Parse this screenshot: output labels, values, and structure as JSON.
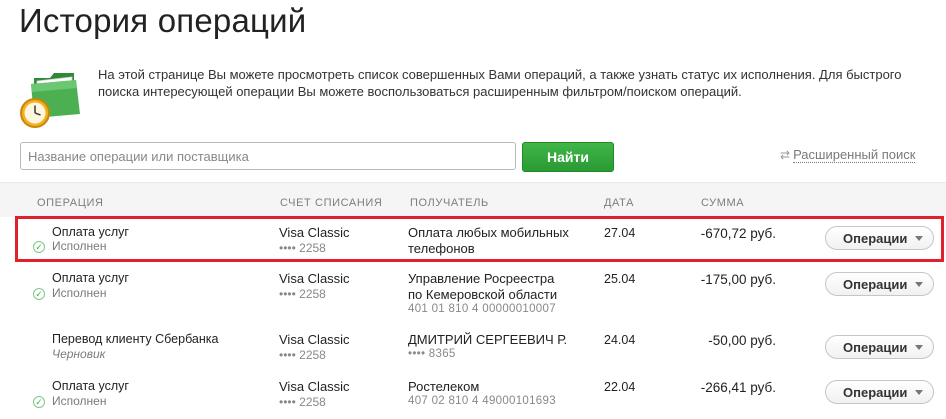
{
  "page": {
    "title": "История операций"
  },
  "intro": {
    "text": "На этой странице Вы можете просмотреть список совершенных Вами операций, а также узнать статус их исполнения. Для быстрого поиска интересующей операции Вы можете воспользоваться расширенным фильтром/поиском операций.",
    "icon": "folder-clock-icon"
  },
  "search": {
    "placeholder": "Название операции или поставщика",
    "value": "",
    "button": "Найти",
    "advanced": "Расширенный поиск"
  },
  "table": {
    "headers": {
      "operation": "ОПЕРАЦИЯ",
      "account": "СЧЕТ СПИСАНИЯ",
      "recipient": "ПОЛУЧАТЕЛЬ",
      "date": "ДАТА",
      "amount": "СУММА"
    },
    "rows": [
      {
        "title": "Оплата услуг",
        "status": "Исполнен",
        "account": "Visa Classic",
        "account_num": "•••• 2258",
        "recipient": "Оплата любых мобильных телефонов",
        "recipient_sub": "",
        "date": "27.04",
        "amount": "-670,72 руб.",
        "action": "Операции"
      },
      {
        "title": "Оплата услуг",
        "status": "Исполнен",
        "account": "Visa Classic",
        "account_num": "•••• 2258",
        "recipient": "Управление Росреестра по Кемеровской области",
        "recipient_sub": "401 01 810 4 00000010007",
        "date": "25.04",
        "amount": "-175,00 руб.",
        "action": "Операции"
      },
      {
        "title": "Перевод клиенту Сбербанка",
        "status": "Черновик",
        "account": "Visa Classic",
        "account_num": "•••• 2258",
        "recipient": "ДМИТРИЙ СЕРГЕЕВИЧ Р.",
        "recipient_sub": "•••• 8365",
        "date": "24.04",
        "amount": "-50,00 руб.",
        "action": "Операции"
      },
      {
        "title": "Оплата услуг",
        "status": "Исполнен",
        "account": "Visa Classic",
        "account_num": "•••• 2258",
        "recipient": "Ростелеком",
        "recipient_sub": "407 02 810 4 49000101693",
        "date": "22.04",
        "amount": "-266,41 руб.",
        "action": "Операции"
      }
    ]
  },
  "colors": {
    "accent_green": "#2a9a33",
    "highlight_red": "#e0202c"
  }
}
